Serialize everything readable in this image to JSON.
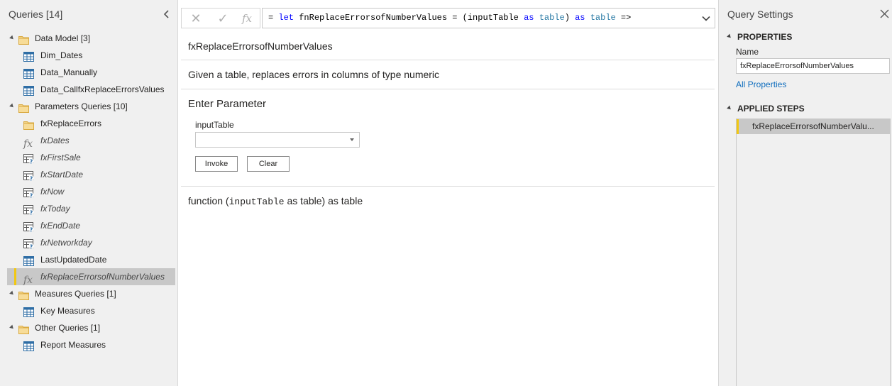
{
  "queries_pane": {
    "title": "Queries [14]",
    "groups": [
      {
        "label": "Data Model [3]",
        "items": [
          {
            "label": "Dim_Dates",
            "icon": "table-icon",
            "italic": false
          },
          {
            "label": "Data_Manually",
            "icon": "table-icon",
            "italic": false
          },
          {
            "label": "Data_CallfxReplaceErrorsValues",
            "icon": "table-icon",
            "italic": false
          }
        ]
      },
      {
        "label": "Parameters Queries [10]",
        "items": [
          {
            "label": "fxReplaceErrors",
            "icon": "folder-icon",
            "italic": false
          },
          {
            "label": "fxDates",
            "icon": "function-icon",
            "italic": true
          },
          {
            "label": "fxFirstSale",
            "icon": "parameter-icon",
            "italic": true
          },
          {
            "label": "fxStartDate",
            "icon": "parameter-icon",
            "italic": true
          },
          {
            "label": "fxNow",
            "icon": "parameter-icon",
            "italic": true
          },
          {
            "label": "fxToday",
            "icon": "parameter-icon",
            "italic": true
          },
          {
            "label": "fxEndDate",
            "icon": "parameter-icon",
            "italic": true
          },
          {
            "label": "fxNetworkday",
            "icon": "parameter-icon",
            "italic": true
          },
          {
            "label": "LastUpdatedDate",
            "icon": "table-icon",
            "italic": false
          },
          {
            "label": "fxReplaceErrorsofNumberValues",
            "icon": "function-icon",
            "italic": true,
            "selected": true
          }
        ]
      },
      {
        "label": "Measures Queries [1]",
        "items": [
          {
            "label": "Key Measures",
            "icon": "table-icon",
            "italic": false
          }
        ]
      },
      {
        "label": "Other Queries [1]",
        "items": [
          {
            "label": "Report Measures",
            "icon": "table-icon",
            "italic": false
          }
        ]
      }
    ]
  },
  "formula_bar": {
    "cancel_glyph": "✕",
    "commit_glyph": "✓",
    "fx_glyph": "fx",
    "parts": {
      "p1": "= ",
      "p2": "let",
      "p3": " fnReplaceErrorsofNumberValues = (inputTable ",
      "p4": "as",
      "p5": " ",
      "p6": "table",
      "p7": ") ",
      "p8": "as",
      "p9": " ",
      "p10": "table",
      "p11": " =>"
    }
  },
  "function_doc": {
    "name": "fxReplaceErrorsofNumberValues",
    "description": "Given a table, replaces errors in columns of type numeric",
    "enter_parameter_heading": "Enter Parameter",
    "parameter_label": "inputTable",
    "parameter_value": "",
    "invoke_label": "Invoke",
    "clear_label": "Clear",
    "signature_prefix": "function (",
    "signature_param": "inputTable",
    "signature_suffix": " as table) as table"
  },
  "query_settings": {
    "title": "Query Settings",
    "properties_heading": "PROPERTIES",
    "name_label": "Name",
    "name_value": "fxReplaceErrorsofNumberValues",
    "all_properties_link": "All Properties",
    "applied_steps_heading": "APPLIED STEPS",
    "steps": [
      "fxReplaceErrorsofNumberValu..."
    ]
  },
  "colors": {
    "accent_yellow": "#f2c811",
    "link_blue": "#106ebe",
    "pane_bg": "#f0f0f0",
    "selection_bg": "#c8c8c8",
    "keyword_blue": "#0000ff",
    "type_teal": "#2b7ba6"
  }
}
